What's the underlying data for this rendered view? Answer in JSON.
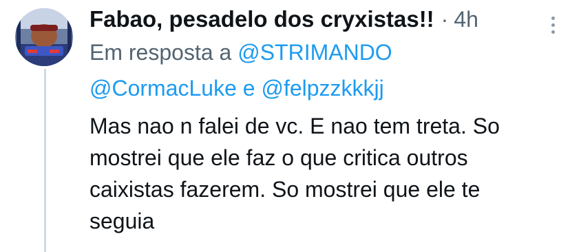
{
  "tweet": {
    "author": {
      "display_name": "Fabao, pesadelo dos cryxistas!!",
      "avatar_icon": "user-avatar"
    },
    "separator": "·",
    "timestamp": "4h",
    "more_icon": "more-vertical-icon",
    "reply_context": {
      "prefix": "Em resposta a",
      "mentions": [
        "@STRIMANDO",
        "@CormacLuke",
        "@felpzzkkkjj"
      ],
      "conjunction": "e"
    },
    "text_lines": [
      "Mas nao n falei de vc. E nao tem treta. So",
      "mostrei que ele faz o que critica outros",
      "caixistas fazerem. So mostrei que ele te",
      "seguia"
    ]
  },
  "colors": {
    "text_primary": "#0f1419",
    "text_secondary": "#536471",
    "link": "#1d9bf0",
    "thread_line": "#cfd9de"
  }
}
